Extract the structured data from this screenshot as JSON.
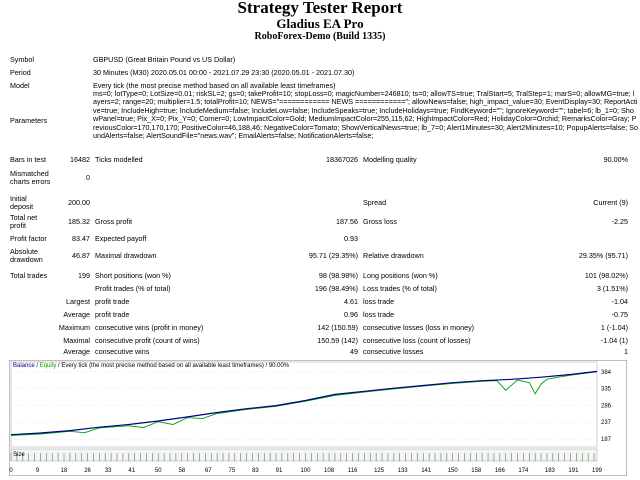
{
  "header": {
    "title": "Strategy Tester Report",
    "ea": "Gladius EA Pro",
    "build": "RoboForex-Demo (Build 1335)"
  },
  "info": {
    "symbol_label": "Symbol",
    "symbol": "GBPUSD (Great Britain Pound vs US Dollar)",
    "period_label": "Period",
    "period": "30 Minutes (M30) 2020.05.01 00:00 - 2021.07.29 23:30 (2020.05.01 - 2021.07.30)",
    "model_label": "Model",
    "model": "Every tick (the most precise method based on all available least timeframes)",
    "parameters_label": "Parameters",
    "parameters": "ms=0; lotType=0; LotSize=0.01; riskSL=2; gs=0; takeProfit=10; stopLoss=0; magicNumber=246810; ts=0; allowTS=true; TralStart=5; TralStep=1; marS=0; allowMG=true; layers=2; range=20; multiplier=1.5; totalProfit=10; NEWS=\"============ NEWS ============\"; allowNews=false; high_impact_value=30; EventDisplay=30; ReportActive=true; IncludeHigh=true; IncludeMedium=false; IncludeLow=false; IncludeSpeaks=true; IncludeHolidays=true; FindKeyword=\"\"; IgnoreKeyword=\"\"; tabel=6; lb_1=0; ShowPanel=true; Pix_X=0; Pix_Y=0; Corner=0; LowImpactColor=Gold; MediumImpactColor=255,115,62; HighImpactColor=Red; HolidayColor=Orchid; RemarksColor=Gray; PreviousColor=170,170,170; PositiveColor=46,188,46; NegativeColor=Tomato; ShowVerticalNews=true; lb_7=0; Alert1Minutes=30; Alert2Minutes=10; PopupAlerts=false; SoundAlerts=false; AlertSoundFile=\"news.wav\"; EmailAlerts=false; NotificationAlerts=false;"
  },
  "stats": {
    "bars_label": "Bars in test",
    "bars": "16482",
    "ticks_label": "Ticks modelled",
    "ticks": "18367026",
    "quality_label": "Modelling quality",
    "quality": "90.00%",
    "mismatch_label_1": "Mismatched",
    "mismatch_label_2": "charts errors",
    "mismatch": "0",
    "deposit_label_1": "Initial",
    "deposit_label_2": "deposit",
    "deposit": "200.00",
    "spread_label": "Spread",
    "spread": "Current (9)",
    "net_label_1": "Total net",
    "net_label_2": "profit",
    "net": "185.32",
    "gross_profit_label": "Gross profit",
    "gross_profit": "187.56",
    "gross_loss_label": "Gross loss",
    "gross_loss": "-2.25",
    "pf_label": "Profit factor",
    "pf": "83.47",
    "payoff_label": "Expected payoff",
    "payoff": "0.93",
    "abs_dd_label_1": "Absolute",
    "abs_dd_label_2": "drawdown",
    "abs_dd": "46.87",
    "max_dd_label": "Maximal drawdown",
    "max_dd": "95.71 (29.35%)",
    "rel_dd_label": "Relative drawdown",
    "rel_dd": "29.35% (95.71)",
    "trades_label": "Total trades",
    "trades": "199",
    "short_label": "Short positions (won %)",
    "short": "98 (98.98%)",
    "long_label": "Long positions (won %)",
    "long": "101 (98.02%)",
    "profit_trades_label": "Profit trades (% of total)",
    "profit_trades": "196 (98.49%)",
    "loss_trades_label": "Loss trades (% of total)",
    "loss_trades": "3 (1.51%)",
    "largest_label": "Largest",
    "largest_profit_label": "profit trade",
    "largest_profit": "4.61",
    "largest_loss_label": "loss trade",
    "largest_loss": "-1.04",
    "average_label": "Average",
    "average_profit_label": "profit trade",
    "average_profit": "0.96",
    "average_loss_label": "loss trade",
    "average_loss": "-0.75",
    "maximum_label": "Maximum",
    "max_wins_label": "consecutive wins (profit in money)",
    "max_wins": "142 (150.59)",
    "max_losses_label": "consecutive losses (loss in money)",
    "max_losses": "1 (-1.04)",
    "maximal_label": "Maximal",
    "maximal_profit_label": "consecutive profit (count of wins)",
    "maximal_profit": "150.59 (142)",
    "maximal_loss_label": "consecutive loss (count of losses)",
    "maximal_loss": "-1.04 (1)",
    "avg_cons_label": "Average",
    "avg_wins_label": "consecutive wins",
    "avg_wins": "49",
    "avg_losses_label": "consecutive losses",
    "avg_losses": "1"
  },
  "chart_data": {
    "type": "line",
    "legend_balance": "Balance",
    "legend_sep": " / ",
    "legend_equity": "Equity",
    "legend_text": " / Every tick (the most precise method based on all available least timeframes) / 90.00%",
    "size_label": "Size",
    "y_ticks": [
      384,
      335,
      286,
      237,
      187
    ],
    "ylim": [
      170,
      395
    ],
    "x_ticks": [
      0,
      9,
      18,
      26,
      33,
      41,
      50,
      58,
      67,
      75,
      83,
      91,
      100,
      108,
      116,
      125,
      133,
      141,
      150,
      158,
      166,
      174,
      183,
      191,
      199
    ],
    "xlim": [
      0,
      199
    ],
    "balance_color": "#00008b",
    "equity_color": "#00a000",
    "balance": [
      [
        0,
        200
      ],
      [
        10,
        205
      ],
      [
        20,
        212
      ],
      [
        30,
        222
      ],
      [
        40,
        230
      ],
      [
        50,
        240
      ],
      [
        60,
        252
      ],
      [
        70,
        265
      ],
      [
        80,
        276
      ],
      [
        90,
        285
      ],
      [
        100,
        300
      ],
      [
        110,
        318
      ],
      [
        120,
        327
      ],
      [
        130,
        336
      ],
      [
        140,
        344
      ],
      [
        150,
        352
      ],
      [
        160,
        358
      ],
      [
        170,
        362
      ],
      [
        180,
        368
      ],
      [
        190,
        376
      ],
      [
        199,
        385
      ]
    ],
    "equity": [
      [
        0,
        198
      ],
      [
        10,
        202
      ],
      [
        20,
        210
      ],
      [
        25,
        206
      ],
      [
        30,
        220
      ],
      [
        40,
        226
      ],
      [
        45,
        221
      ],
      [
        50,
        238
      ],
      [
        55,
        230
      ],
      [
        60,
        250
      ],
      [
        65,
        247
      ],
      [
        70,
        262
      ],
      [
        80,
        274
      ],
      [
        90,
        283
      ],
      [
        100,
        298
      ],
      [
        110,
        315
      ],
      [
        120,
        325
      ],
      [
        130,
        334
      ],
      [
        140,
        342
      ],
      [
        150,
        350
      ],
      [
        160,
        356
      ],
      [
        165,
        358
      ],
      [
        168,
        330
      ],
      [
        172,
        360
      ],
      [
        176,
        352
      ],
      [
        178,
        320
      ],
      [
        180,
        348
      ],
      [
        182,
        362
      ],
      [
        185,
        367
      ],
      [
        190,
        374
      ],
      [
        199,
        384
      ]
    ]
  }
}
